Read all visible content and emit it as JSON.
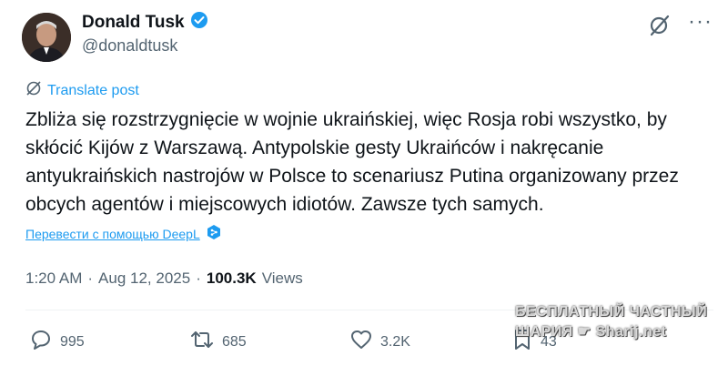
{
  "author": {
    "name": "Donald Tusk",
    "handle": "@donaldtusk"
  },
  "translate_post": "Translate post",
  "post_text": "Zbliża się rozstrzygnięcie w wojnie ukraińskiej, więc Rosja robi wszystko, by skłócić Kijów z Warszawą. Antypolskie gesty Ukraińców i nakręcanie antyukraińskich nastrojów w Polsce to scenariusz Putina organizowany przez obcych agentów i miejscowych idiotów. Zawsze tych samych.",
  "deepl_link": "Перевести с помощью DeepL",
  "meta": {
    "time": "1:20 AM",
    "sep1": "·",
    "date": "Aug 12, 2025",
    "sep2": "·",
    "views_count": "100.3K",
    "views_label": "Views"
  },
  "actions": {
    "replies": "995",
    "reposts": "685",
    "likes": "3.2K",
    "bookmarks": "43"
  },
  "watermark": {
    "line1": "БЕСПЛАТНЫЙ ЧАСТНЫЙ",
    "line2": "ШАРИЯ",
    "line3": "Sharij.net"
  },
  "colors": {
    "accent": "#1d9bf0",
    "verified": "#1d9bf0",
    "muted": "#536471",
    "text": "#0f1419"
  },
  "icons": [
    "verified-badge-icon",
    "grok-icon",
    "more-icon",
    "translate-icon",
    "deepl-icon",
    "reply-icon",
    "repost-icon",
    "like-icon",
    "bookmark-icon"
  ]
}
